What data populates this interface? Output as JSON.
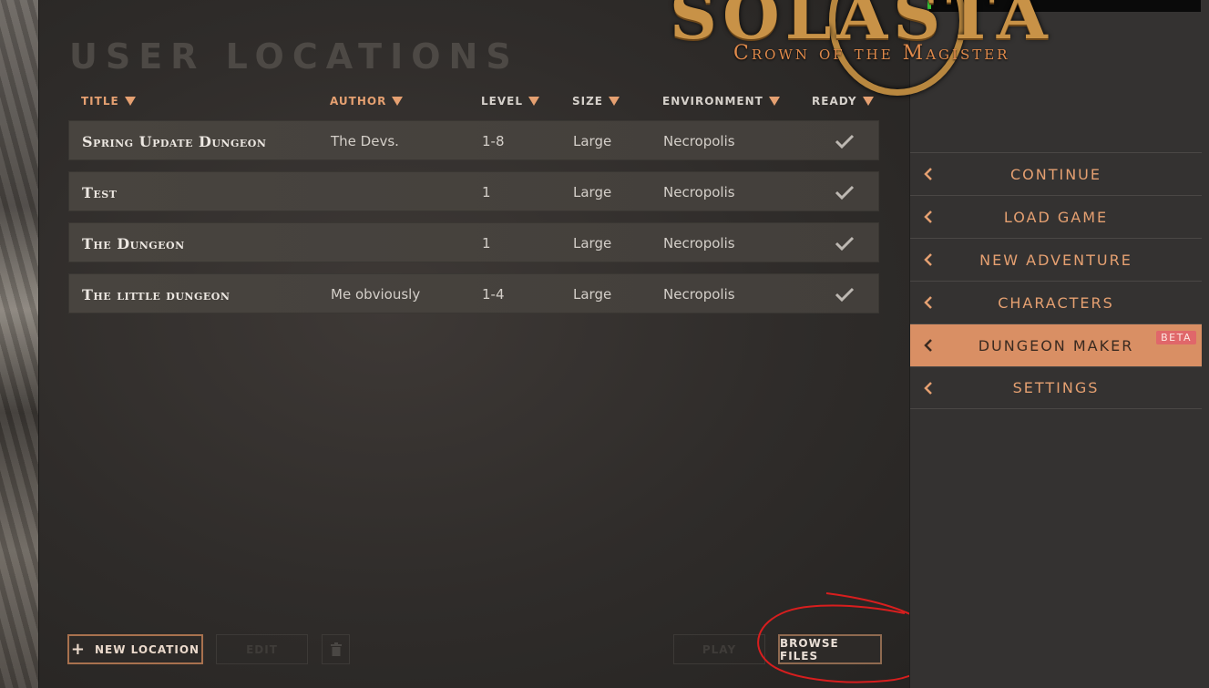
{
  "page": {
    "title": "USER LOCATIONS"
  },
  "logo": {
    "title": "SOLASTA",
    "subtitle": "Crown of the Magister"
  },
  "columns": [
    {
      "key": "title",
      "label": "TITLE",
      "sorted": true
    },
    {
      "key": "author",
      "label": "AUTHOR",
      "sorted": true
    },
    {
      "key": "level",
      "label": "LEVEL",
      "sorted": true
    },
    {
      "key": "size",
      "label": "SIZE",
      "sorted": true
    },
    {
      "key": "environment",
      "label": "ENVIRONMENT",
      "sorted": true
    },
    {
      "key": "ready",
      "label": "READY",
      "sorted": true
    }
  ],
  "rows": [
    {
      "title": "Spring Update Dungeon",
      "author": "The Devs.",
      "level": "1-8",
      "size": "Large",
      "environment": "Necropolis",
      "ready": true
    },
    {
      "title": "Test",
      "author": "",
      "level": "1",
      "size": "Large",
      "environment": "Necropolis",
      "ready": true
    },
    {
      "title": "The Dungeon",
      "author": "",
      "level": "1",
      "size": "Large",
      "environment": "Necropolis",
      "ready": true
    },
    {
      "title": "The little dungeon",
      "author": "Me obviously",
      "level": "1-4",
      "size": "Large",
      "environment": "Necropolis",
      "ready": true
    }
  ],
  "buttons": {
    "new_location": "NEW LOCATION",
    "edit": "EDIT",
    "play": "PLAY",
    "browse_files": "BROWSE FILES"
  },
  "menu": {
    "items": [
      {
        "label": "CONTINUE",
        "active": false
      },
      {
        "label": "LOAD GAME",
        "active": false
      },
      {
        "label": "NEW ADVENTURE",
        "active": false
      },
      {
        "label": "CHARACTERS",
        "active": false
      },
      {
        "label": "DUNGEON MAKER",
        "active": true,
        "badge": "BETA"
      },
      {
        "label": "SETTINGS",
        "active": false
      }
    ]
  },
  "colors": {
    "accent": "#e5a071",
    "active_menu_bg": "#d98f64",
    "beta_badge": "#e0676a",
    "annotation": "#d81e1e"
  },
  "icons": [
    "sort-down-icon",
    "checkmark-icon",
    "plus-icon",
    "trash-icon",
    "chevron-left-icon"
  ]
}
